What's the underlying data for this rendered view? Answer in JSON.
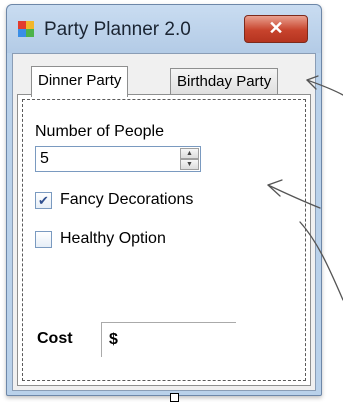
{
  "window": {
    "title": "Party Planner 2.0",
    "close_glyph": "✕"
  },
  "tabs": [
    {
      "label": "Dinner Party",
      "active": true
    },
    {
      "label": "Birthday Party",
      "active": false
    }
  ],
  "form": {
    "people_label": "Number of People",
    "people_value": "5",
    "spin_up_glyph": "▲",
    "spin_down_glyph": "▼",
    "fancy_label": "Fancy Decorations",
    "fancy_checked": true,
    "fancy_check_glyph": "✔",
    "healthy_label": "Healthy Option",
    "healthy_checked": false,
    "cost_label": "Cost",
    "cost_value": "$"
  },
  "colors": {
    "titlebar": "#b9d1ea",
    "close_button": "#c7432c",
    "panel_bg": "#ffffff"
  },
  "icons": [
    "app-icon",
    "close-icon",
    "spin-up-icon",
    "spin-down-icon",
    "checkmark-icon"
  ]
}
